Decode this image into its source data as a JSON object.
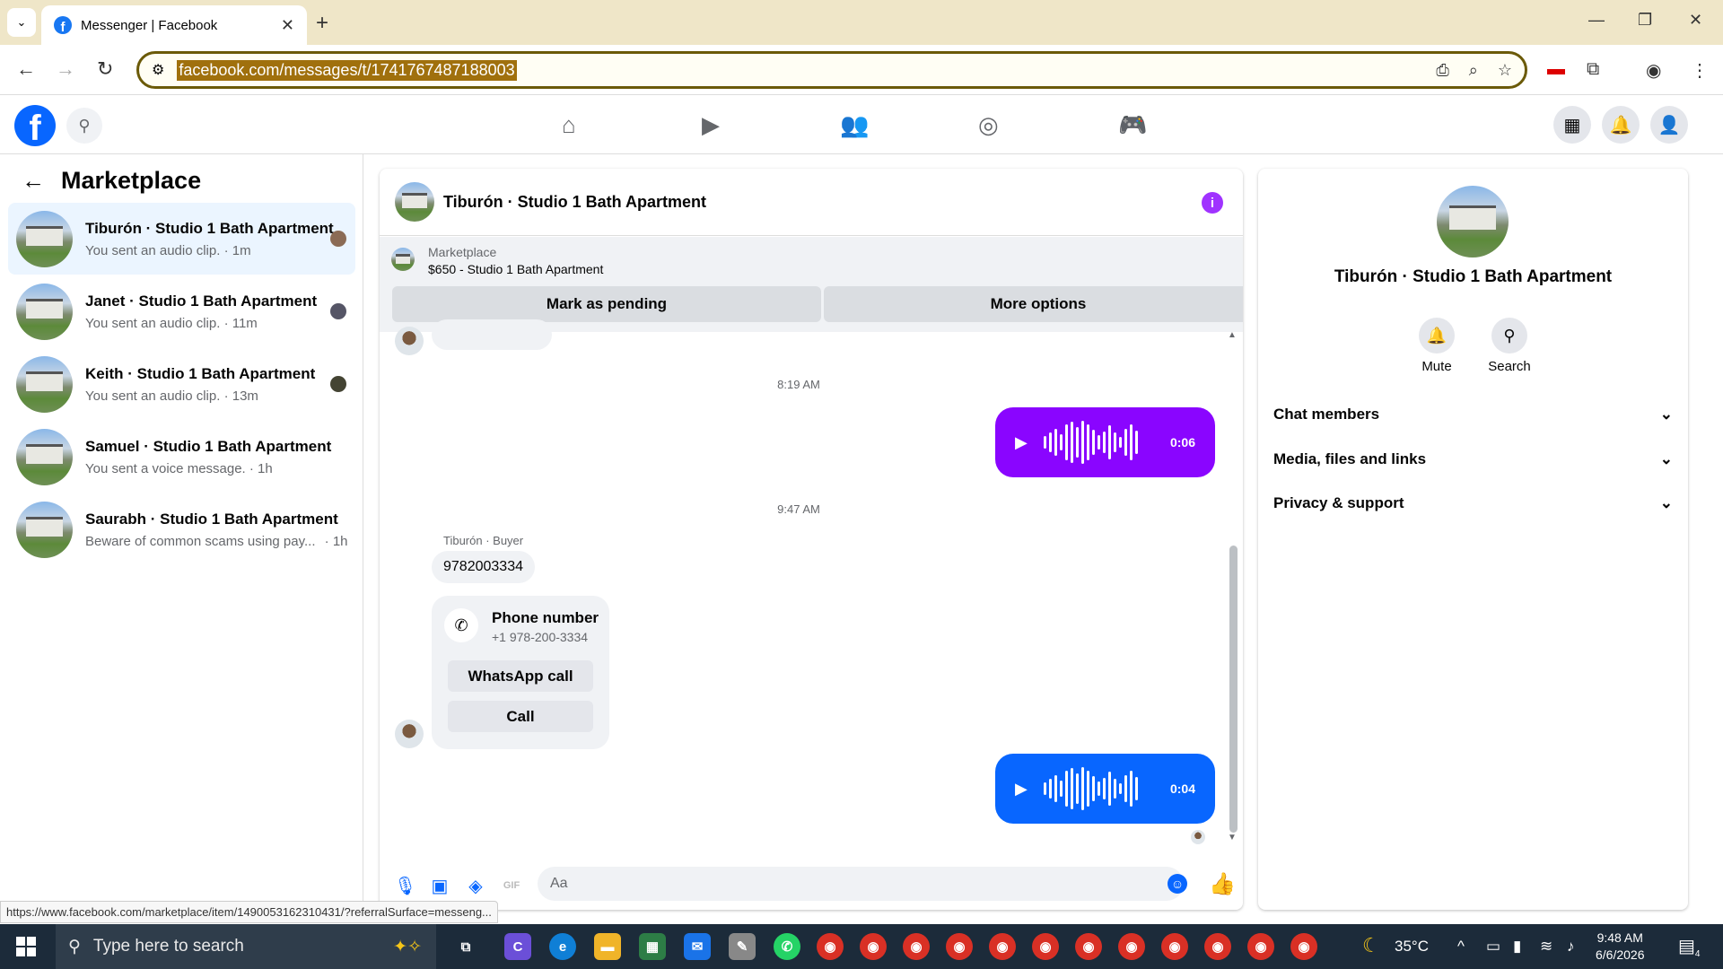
{
  "browser": {
    "tab_title": "Messenger | Facebook",
    "url": "facebook.com/messages/t/1741767487188003",
    "status_url": "https://www.facebook.com/marketplace/item/1490053162310431/?referralSurface=messeng..."
  },
  "sidebar": {
    "title": "Marketplace",
    "conversations": [
      {
        "name": "Tiburón · Studio 1 Bath Apartment",
        "snippet": "You sent an audio clip. · 1m"
      },
      {
        "name": "Janet · Studio 1 Bath Apartment",
        "snippet": "You sent an audio clip. · 11m"
      },
      {
        "name": "Keith · Studio 1 Bath Apartment",
        "snippet": "You sent an audio clip. · 13m"
      },
      {
        "name": "Samuel · Studio 1 Bath Apartment",
        "snippet": "You sent a voice message. · 1h"
      },
      {
        "name": "Saurabh · Studio 1 Bath Apartment",
        "snippet": "Beware of common scams using pay...",
        "time": "· 1h"
      }
    ]
  },
  "chat": {
    "title": "Tiburón · Studio 1 Bath Apartment",
    "listing": {
      "label": "Marketplace",
      "price_title": "$650 - Studio 1 Bath Apartment",
      "mark_pending": "Mark as pending",
      "more_options": "More options"
    },
    "messages": {
      "time1": "8:19 AM",
      "audio1_duration": "0:06",
      "audio1_color": "#8a05ff",
      "time2": "9:47 AM",
      "sender_label": "Tiburón · Buyer",
      "phone_text": "9782003334",
      "phone_card_title": "Phone number",
      "phone_card_number": "+1 978-200-3334",
      "whatsapp_call": "WhatsApp call",
      "call": "Call",
      "audio2_duration": "0:04",
      "audio2_color": "#0866ff"
    },
    "composer_placeholder": "Aa"
  },
  "details": {
    "title": "Tiburón · Studio 1 Bath Apartment",
    "mute": "Mute",
    "search": "Search",
    "sections": [
      "Chat members",
      "Media, files and links",
      "Privacy & support"
    ]
  },
  "taskbar": {
    "search_placeholder": "Type here to search",
    "temperature": "35°C",
    "time": "9:48 AM",
    "date": "6/6/2026",
    "notif_count": "4"
  }
}
